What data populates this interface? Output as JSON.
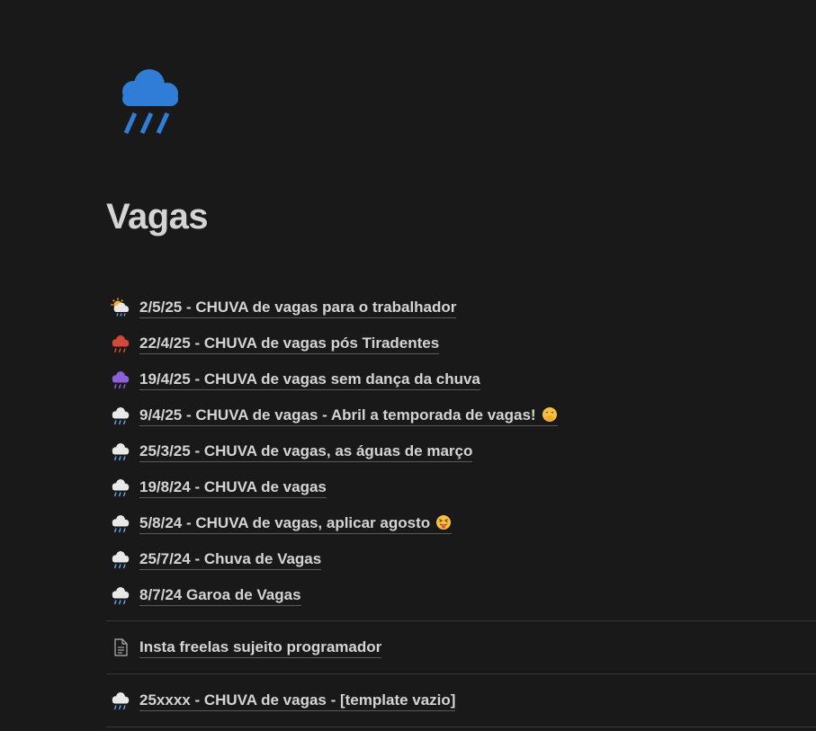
{
  "page": {
    "title": "Vagas",
    "icon": "rain-cloud-icon"
  },
  "links": [
    {
      "label": "2/5/25 - CHUVA de vagas para o trabalhador",
      "icon": "sun-behind-rain-cloud-icon"
    },
    {
      "label": "22/4/25 - CHUVA de vagas pós Tiradentes",
      "icon": "red-rain-cloud-icon"
    },
    {
      "label": "19/4/25 - CHUVA de vagas sem dança da chuva",
      "icon": "purple-rain-cloud-icon"
    },
    {
      "label": "9/4/25 - CHUVA de vagas - Abril a temporada de vagas!",
      "icon": "rain-cloud-icon",
      "trailing_emoji": "face-with-hand-over-mouth-icon"
    },
    {
      "label": "25/3/25 - CHUVA de vagas, as águas de março",
      "icon": "rain-cloud-icon"
    },
    {
      "label": "19/8/24 - CHUVA de vagas",
      "icon": "rain-cloud-icon"
    },
    {
      "label": "5/8/24 - CHUVA de vagas, aplicar agosto",
      "icon": "rain-cloud-icon",
      "trailing_emoji": "squinting-face-with-tongue-icon"
    },
    {
      "label": "25/7/24 - Chuva de Vagas",
      "icon": "rain-cloud-icon"
    },
    {
      "label": "8/7/24 Garoa de Vagas",
      "icon": "rain-cloud-icon"
    }
  ],
  "extra_pages": [
    {
      "label": "Insta freelas sujeito programador",
      "icon": "document-icon"
    },
    {
      "label": "25xxxx - CHUVA de vagas - [template vazio]",
      "icon": "rain-cloud-icon"
    }
  ],
  "colors": {
    "background": "#191919",
    "text": "#d4d4d4",
    "cloud_blue": "#2f7dd6",
    "cloud_red": "#d4483b",
    "cloud_purple": "#8e5fd6",
    "cloud_white": "#e8e8e8",
    "divider": "#373737"
  }
}
